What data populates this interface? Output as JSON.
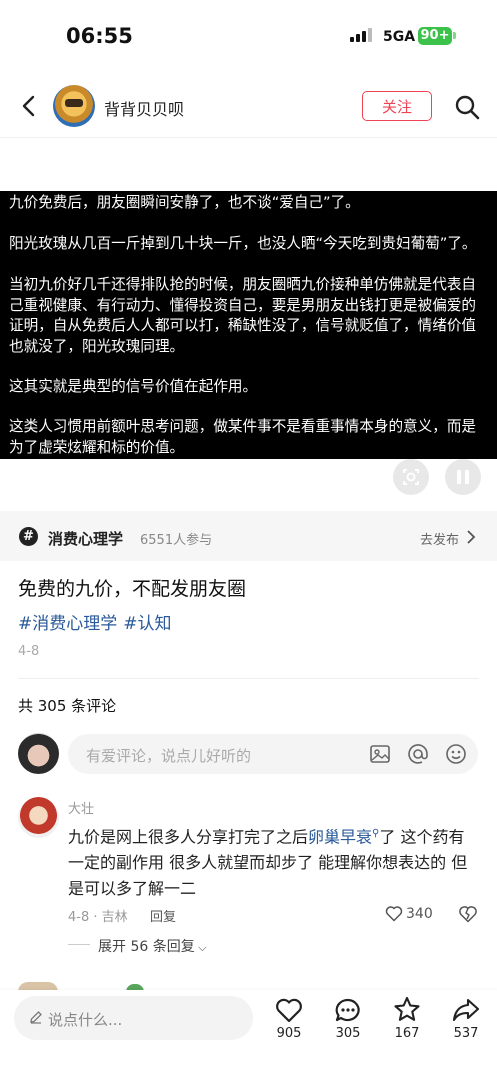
{
  "status_bar": {
    "time": "06:55",
    "network": "5GA",
    "battery": "90+"
  },
  "header": {
    "author": "背背贝贝呗",
    "follow_label": "关注"
  },
  "video_text": {
    "p1": "九价免费后，朋友圈瞬间安静了，也不谈“爱自己”了。",
    "p2": "阳光玫瑰从几百一斤掉到几十块一斤，也没人晒“今天吃到贵妇葡萄”了。",
    "p3": "当初九价好几千还得排队抢的时候，朋友圈晒九价接种单仿佛就是代表自己重视健康、有行动力、懂得投资自己，要是男朋友出钱打更是被偏爱的证明，自从免费后人人都可以打，稀缺性没了，信号就贬值了，情绪价值也就没了，阳光玫瑰同理。",
    "p4": "这其实就是典型的信号价值在起作用。",
    "p5": "这类人习惯用前额叶思考问题，做某件事不是看重事情本身的意义，而是为了虚荣炫耀和标的价值。"
  },
  "topic": {
    "name": "消费心理学",
    "count": "6551人参与",
    "action": "去发布"
  },
  "post": {
    "title": "免费的九价，不配发朋友圈",
    "tags": [
      "#消费心理学",
      "#认知"
    ],
    "date": "4-8"
  },
  "comments": {
    "count_label": "共 305 条评论",
    "input_placeholder": "有爱评论，说点儿好听的",
    "items": [
      {
        "name": "大壮",
        "text_before": "九价是网上很多人分享打完了之后",
        "link": "卵巢早衰",
        "text_after": "了  这个药有一定的副作用 很多人就望而却步了 能理解你想表达的 但是可以多了解一二",
        "meta": "4-8 · 吉林",
        "reply_label": "回复",
        "likes": "340",
        "expand_label": "展开 56 条回复"
      }
    ]
  },
  "bottom_bar": {
    "placeholder": "说点什么...",
    "likes": "905",
    "comments": "305",
    "favorites": "167",
    "shares": "537"
  },
  "colors": {
    "accent": "#ee4455",
    "link": "#2a5a9a",
    "battery": "#3cc24a"
  }
}
